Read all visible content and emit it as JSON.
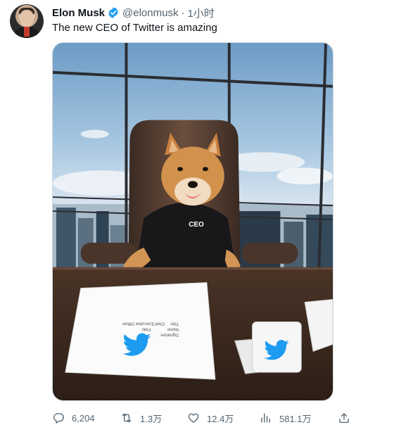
{
  "author": {
    "name": "Elon Musk",
    "handle": "@elonmusk",
    "separator": "·",
    "time": "1小时"
  },
  "tweet": {
    "text": "The new CEO of Twitter is amazing"
  },
  "photo": {
    "sweater_text": "CEO",
    "paper_lines": [
      "Signature:",
      "Name:",
      "Title:",
      "Floki",
      "Chief Executive Officer"
    ]
  },
  "actions": {
    "replies": "6,204",
    "retweets": "1.3万",
    "likes": "12.4万",
    "views": "581.1万"
  },
  "colors": {
    "verified": "#1d9bf0",
    "twitter_blue": "#1d9bf0",
    "secondary_text": "#536471"
  }
}
